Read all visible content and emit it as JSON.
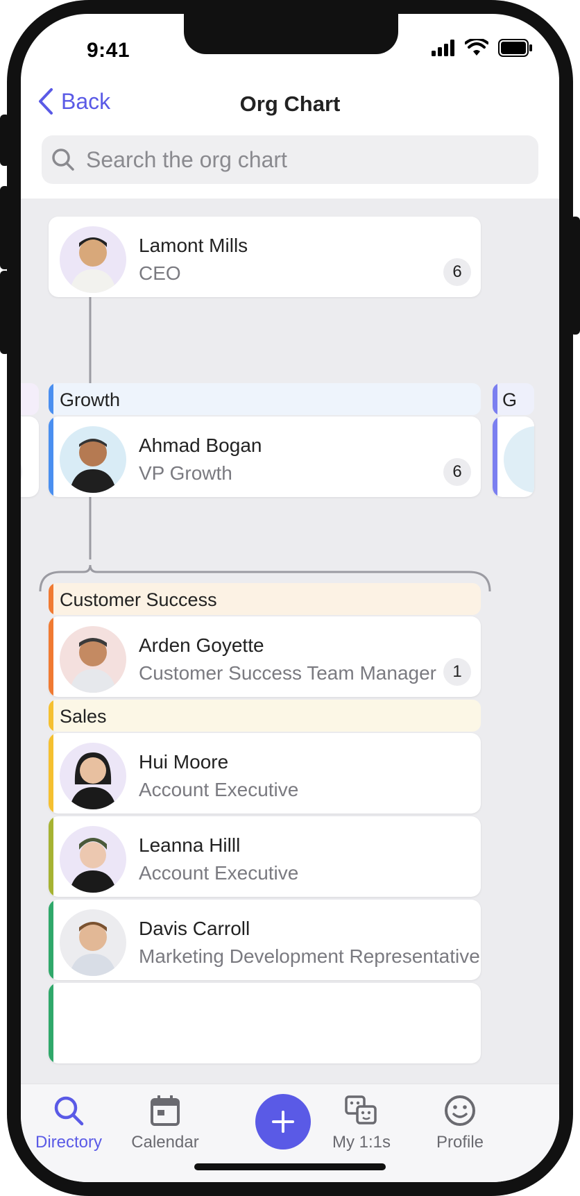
{
  "status": {
    "time": "9:41"
  },
  "header": {
    "back_label": "Back",
    "title": "Org Chart"
  },
  "search": {
    "placeholder": "Search the org chart"
  },
  "ceo": {
    "name": "Lamont Mills",
    "role": "CEO",
    "count": "6"
  },
  "growth": {
    "team": "Growth",
    "name": "Ahmad Bogan",
    "role": "VP Growth",
    "count": "6",
    "next_team_partial": "G"
  },
  "reports": [
    {
      "team": "Customer Success",
      "name": "Arden Goyette",
      "role": "Customer Success Team Manager",
      "count": "1"
    },
    {
      "team": "Sales",
      "name": "Hui Moore",
      "role": "Account Executive"
    },
    {
      "name": "Leanna Hilll",
      "role": "Account Executive"
    },
    {
      "name": "Davis Carroll",
      "role": "Marketing Development Representative"
    }
  ],
  "tabs": [
    {
      "label": "Directory",
      "icon": "search-icon",
      "active": true
    },
    {
      "label": "Calendar",
      "icon": "calendar-icon"
    },
    {
      "label": "",
      "icon": "plus-icon"
    },
    {
      "label": "My 1:1s",
      "icon": "faces-icon"
    },
    {
      "label": "Profile",
      "icon": "smiley-icon"
    }
  ],
  "colors": {
    "accent": "#5a5ae6",
    "growth": "#4a8ff0",
    "customer_success": "#f07a32",
    "sales": "#f5c030",
    "leanna": "#a6b332",
    "davis": "#2fa86a"
  }
}
